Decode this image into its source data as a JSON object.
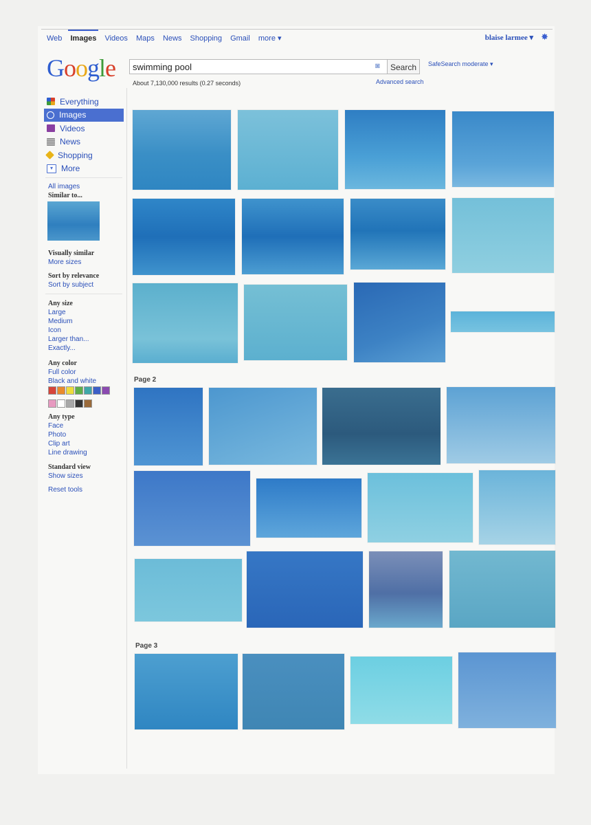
{
  "topnav": {
    "links": [
      "Web",
      "Images",
      "Videos",
      "Maps",
      "News",
      "Shopping",
      "Gmail",
      "more ▾"
    ],
    "user": "blaise larmee ▾"
  },
  "logo": "Google",
  "search": {
    "query": "swimming pool",
    "button": "Search",
    "safesearch": "SafeSearch moderate ▾",
    "results": "About 7,130,000 results (0.27 seconds)",
    "advanced": "Advanced search"
  },
  "leftnav": {
    "items": [
      {
        "label": "Everything",
        "icon": "everything-icon",
        "color": "#3f9b3a"
      },
      {
        "label": "Images",
        "icon": "camera-icon",
        "color": "#ffffff"
      },
      {
        "label": "Videos",
        "icon": "video-icon",
        "color": "#8a3fa1"
      },
      {
        "label": "News",
        "icon": "news-icon",
        "color": "#8d8d8d"
      },
      {
        "label": "Shopping",
        "icon": "tag-icon",
        "color": "#e8b418"
      },
      {
        "label": "More",
        "icon": "chevron-down-icon",
        "color": "#4a6fd0"
      }
    ]
  },
  "sidebar": {
    "all_images": "All images",
    "similar_to": "Similar to...",
    "visually_similar": "Visually similar",
    "more_sizes": "More sizes",
    "sort_relevance": "Sort by relevance",
    "sort_subject": "Sort by subject",
    "size_header": "Any size",
    "sizes": [
      "Large",
      "Medium",
      "Icon",
      "Larger than...",
      "Exactly..."
    ],
    "color_header": "Any color",
    "colors": [
      "Full color",
      "Black and white"
    ],
    "swatch_colors": [
      "#d6453a",
      "#e98a2c",
      "#eedc3b",
      "#5fae4a",
      "#3fa7a8",
      "#3d5fc7",
      "#8b4bb0",
      "#e79ac0",
      "#ffffff",
      "#a8a8a8",
      "#333333",
      "#9a6a3a"
    ],
    "type_header": "Any type",
    "types": [
      "Face",
      "Photo",
      "Clip art",
      "Line drawing"
    ],
    "view_header": "Standard view",
    "show_sizes": "Show sizes",
    "reset": "Reset tools"
  },
  "pages": [
    "Page 2",
    "Page 3"
  ]
}
